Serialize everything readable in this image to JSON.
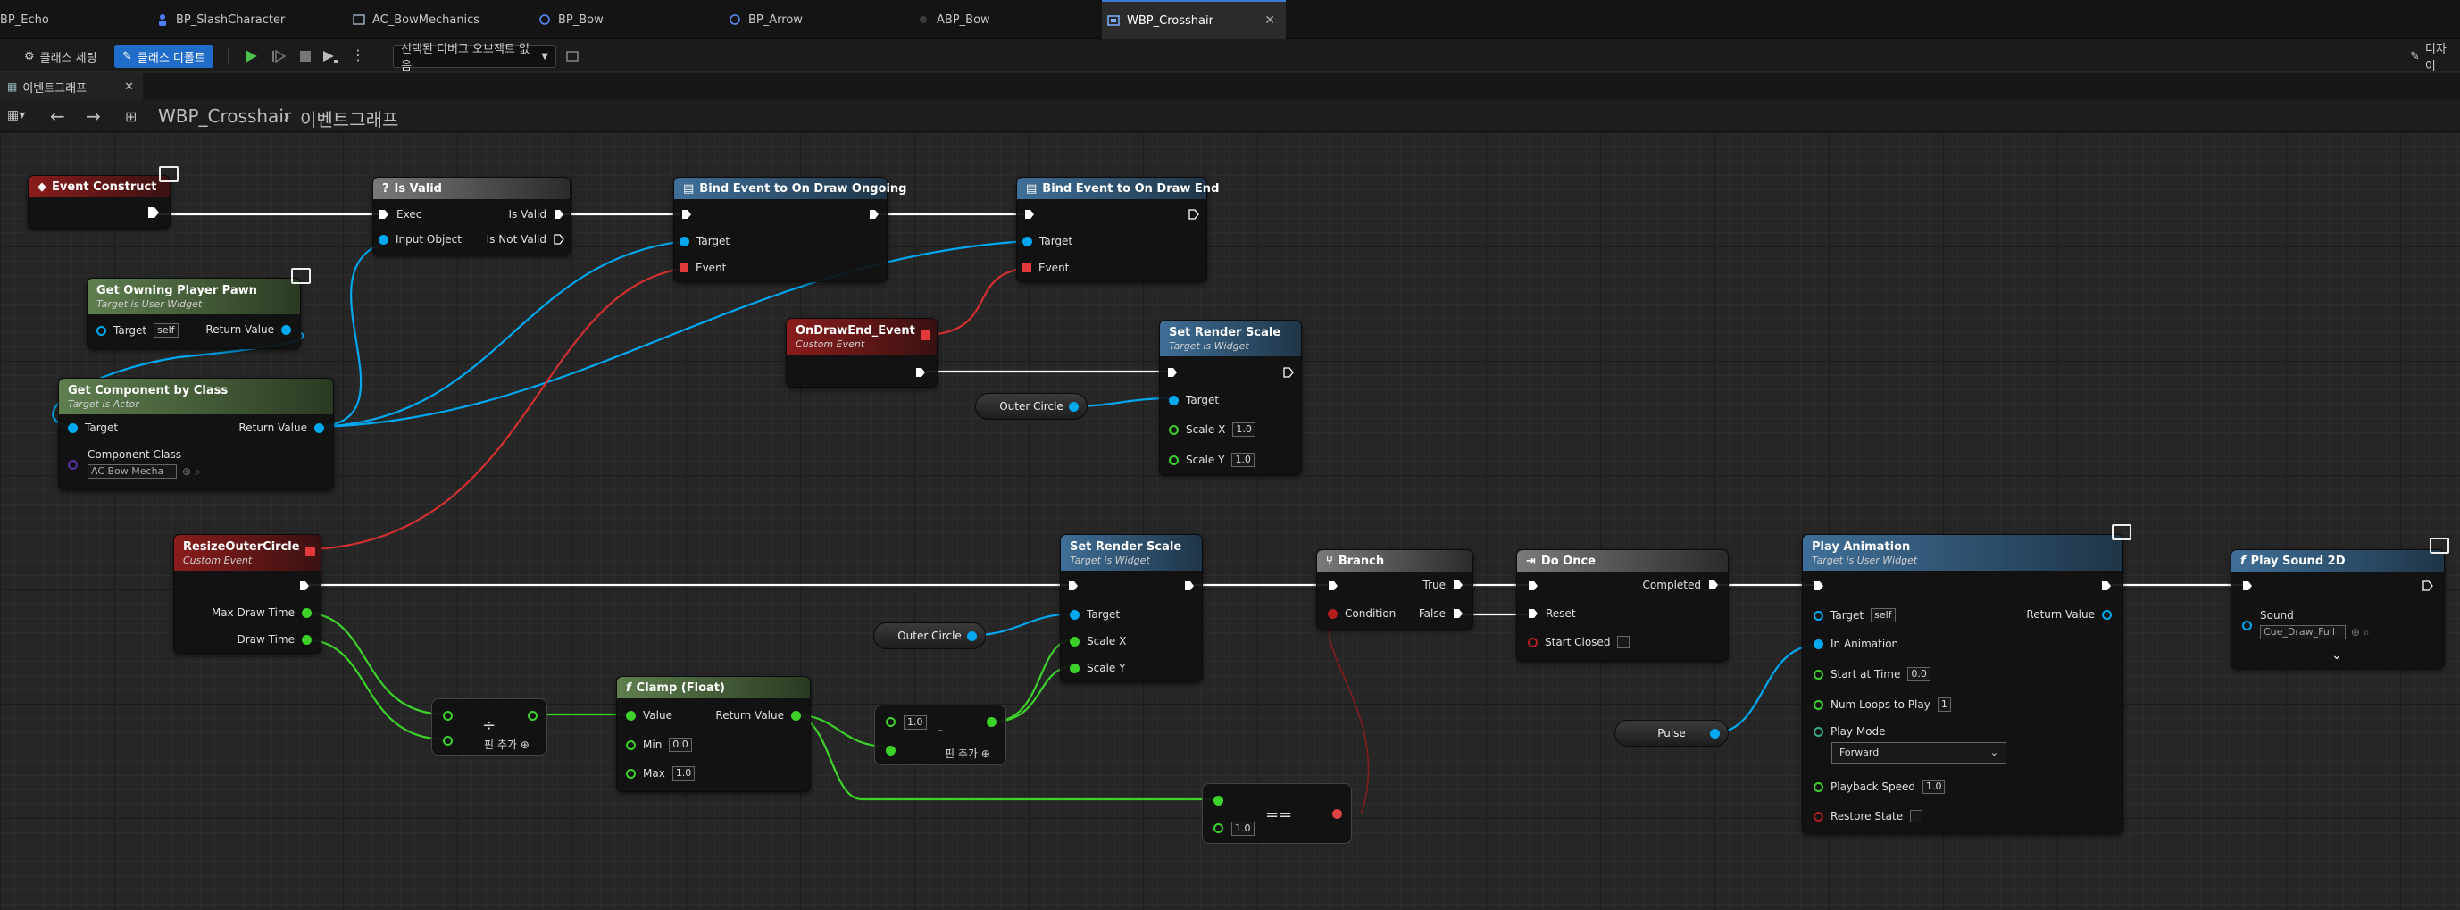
{
  "tabs": [
    {
      "label": "BP_Echo",
      "icon": "blueprint-icon"
    },
    {
      "label": "BP_SlashCharacter",
      "icon": "character-icon"
    },
    {
      "label": "AC_BowMechanics",
      "icon": "blueprint-icon"
    },
    {
      "label": "BP_Bow",
      "icon": "blueprint-icon"
    },
    {
      "label": "BP_Arrow",
      "icon": "blueprint-icon"
    },
    {
      "label": "ABP_Bow",
      "icon": "anim-blueprint-icon"
    },
    {
      "label": "WBP_Crosshair",
      "icon": "widget-blueprint-icon",
      "active": true
    }
  ],
  "toolbar": {
    "class_settings": "클래스 세팅",
    "class_defaults": "클래스 디폴트",
    "debug_object": "선택된 디버그 오브젝트 없음",
    "designer": "디자이"
  },
  "graph_tab": {
    "label": "이벤트그래프"
  },
  "breadcrumb": {
    "root": "WBP_Crosshair",
    "separator": "›",
    "graph": "이벤트그래프"
  },
  "nodes": {
    "event_construct": {
      "title": "Event Construct"
    },
    "is_valid": {
      "title": "Is Valid",
      "exec": "Exec",
      "input": "Input Object",
      "out_valid": "Is Valid",
      "out_not_valid": "Is Not Valid"
    },
    "bind_ongoing": {
      "title": "Bind Event to On Draw Ongoing",
      "target": "Target",
      "event": "Event"
    },
    "bind_end": {
      "title": "Bind Event to On Draw End",
      "target": "Target",
      "event": "Event"
    },
    "get_owning_pawn": {
      "title": "Get Owning Player Pawn",
      "subtitle": "Target is User Widget",
      "target": "Target",
      "target_val": "self",
      "ret": "Return Value"
    },
    "get_component": {
      "title": "Get Component by Class",
      "subtitle": "Target is Actor",
      "target": "Target",
      "ret": "Return Value",
      "class_label": "Component Class",
      "class_val": "AC Bow Mecha"
    },
    "on_draw_end": {
      "title": "OnDrawEnd_Event",
      "subtitle": "Custom Event"
    },
    "set_render_scale_1": {
      "title": "Set Render Scale",
      "subtitle": "Target is Widget",
      "target": "Target",
      "sx": "Scale X",
      "sx_val": "1.0",
      "sy": "Scale Y",
      "sy_val": "1.0"
    },
    "outer_circle_1": {
      "label": "Outer Circle"
    },
    "resize_outer": {
      "title": "ResizeOuterCircle",
      "subtitle": "Custom Event",
      "max": "Max Draw Time",
      "draw": "Draw Time"
    },
    "set_render_scale_2": {
      "title": "Set Render Scale",
      "subtitle": "Target is Widget",
      "target": "Target",
      "sx": "Scale X",
      "sy": "Scale Y"
    },
    "outer_circle_2": {
      "label": "Outer Circle"
    },
    "divide": {
      "symbol": "÷",
      "add": "핀 추가"
    },
    "clamp": {
      "title": "Clamp (Float)",
      "value": "Value",
      "ret": "Return Value",
      "min": "Min",
      "min_val": "0.0",
      "max": "Max",
      "max_val": "1.0"
    },
    "subtract": {
      "symbol": "-",
      "val": "1.0",
      "add": "핀 추가"
    },
    "equal": {
      "symbol": "==",
      "val": "1.0"
    },
    "branch": {
      "title": "Branch",
      "cond": "Condition",
      "t": "True",
      "f": "False"
    },
    "do_once": {
      "title": "Do Once",
      "completed": "Completed",
      "reset": "Reset",
      "start_closed": "Start Closed"
    },
    "play_anim": {
      "title": "Play Animation",
      "subtitle": "Target is User Widget",
      "target": "Target",
      "target_val": "self",
      "ret": "Return Value",
      "in_anim": "In Animation",
      "start": "Start at Time",
      "start_val": "0.0",
      "loops": "Num Loops to Play",
      "loops_val": "1",
      "mode": "Play Mode",
      "mode_val": "Forward",
      "speed": "Playback Speed",
      "speed_val": "1.0",
      "restore": "Restore State"
    },
    "pulse": {
      "label": "Pulse"
    },
    "play_sound": {
      "title": "Play Sound 2D",
      "sound": "Sound",
      "sound_val": "Cue_Draw_Full"
    }
  },
  "colors": {
    "exec": "#ffffff",
    "object": "#00a8f0",
    "float": "#3cd22a",
    "bool": "#b41e1e",
    "delegate": "#e23a3a",
    "class": "#5a2fa3"
  }
}
